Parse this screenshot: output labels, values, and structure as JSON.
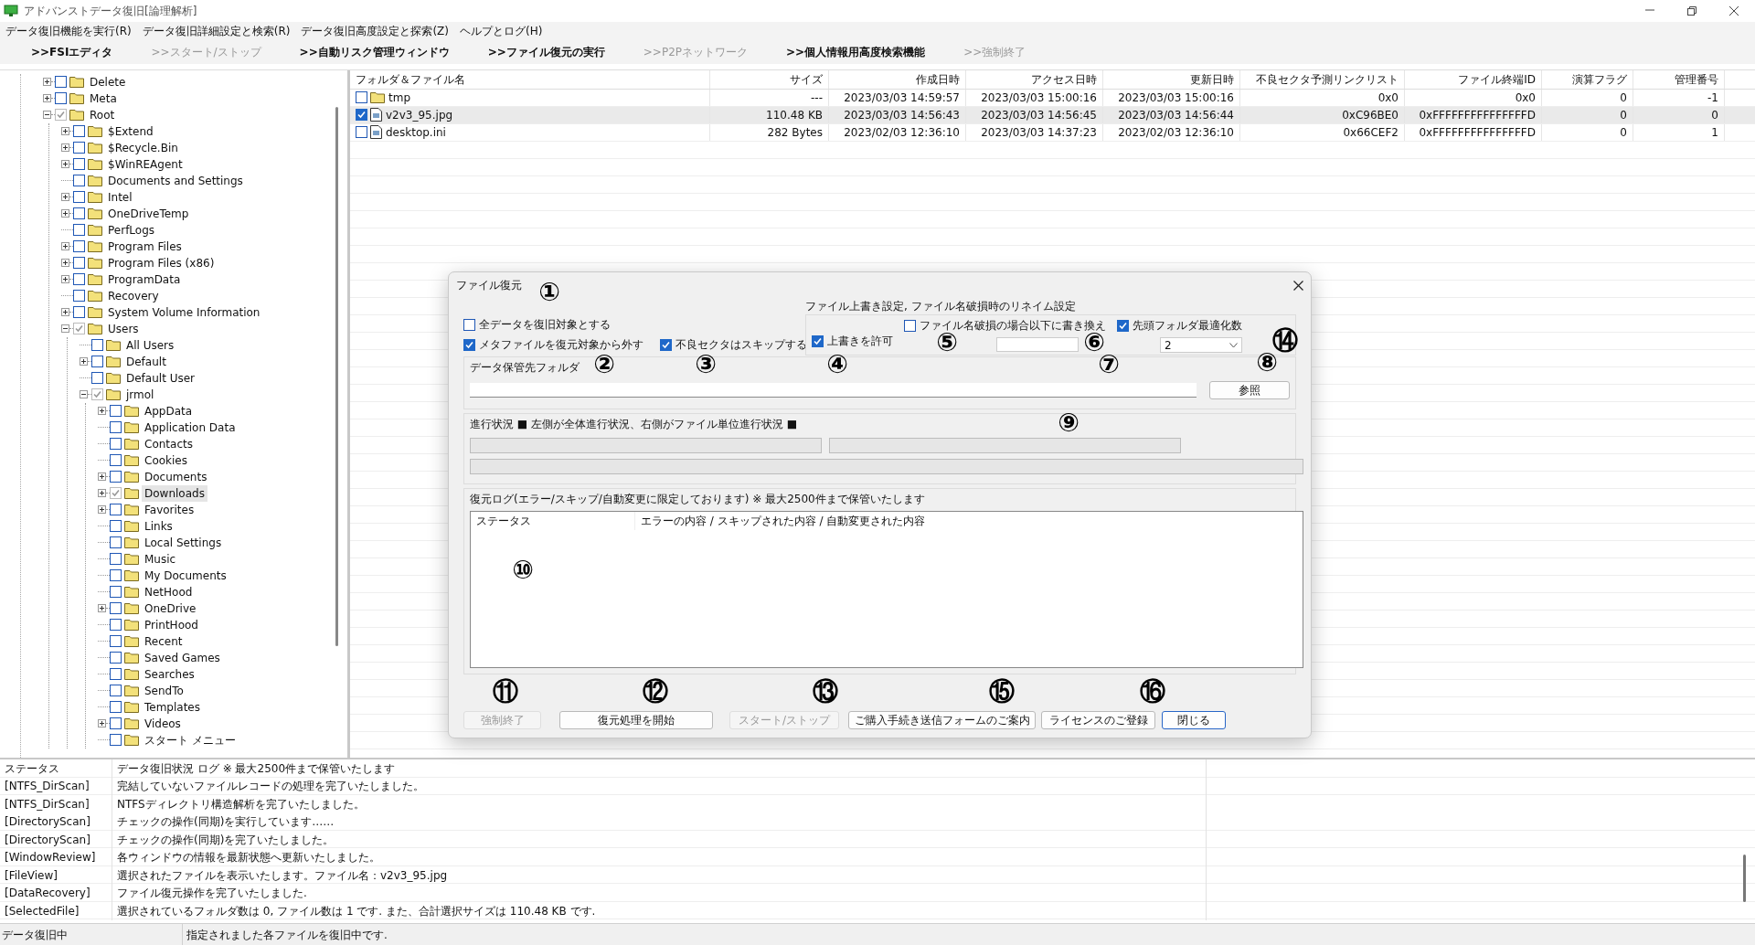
{
  "window": {
    "title": "アドバンストデータ復旧[論理解析]"
  },
  "menu": [
    "データ復旧機能を実行(R)",
    "データ復旧詳細設定と検索(R)",
    "データ復旧高度設定と探索(Z)",
    "ヘルプとログ(H)"
  ],
  "toolbar": [
    {
      "label": ">>FSIエディタ",
      "disabled": false
    },
    {
      "label": ">>スタート/ストップ",
      "disabled": true
    },
    {
      "label": ">>自動リスク管理ウィンドウ",
      "disabled": false
    },
    {
      "label": ">>ファイル復元の実行",
      "disabled": false
    },
    {
      "label": ">>P2Pネットワーク",
      "disabled": true
    },
    {
      "label": ">>個人情報用高度検索機能",
      "disabled": false
    },
    {
      "label": ">>強制終了",
      "disabled": true
    }
  ],
  "tree": [
    {
      "label": "Delete",
      "kind": "collapsed",
      "checked": false,
      "selected": false
    },
    {
      "label": "Meta",
      "kind": "collapsed",
      "checked": false,
      "selected": false
    },
    {
      "label": "Root",
      "kind": "expanded",
      "checked": true,
      "selected": false,
      "children": [
        {
          "label": "$Extend",
          "kind": "collapsed",
          "checked": false,
          "selected": false
        },
        {
          "label": "$Recycle.Bin",
          "kind": "collapsed",
          "checked": false,
          "selected": false
        },
        {
          "label": "$WinREAgent",
          "kind": "collapsed",
          "checked": false,
          "selected": false
        },
        {
          "label": "Documents and Settings",
          "kind": "leaf",
          "checked": false,
          "selected": false
        },
        {
          "label": "Intel",
          "kind": "collapsed",
          "checked": false,
          "selected": false
        },
        {
          "label": "OneDriveTemp",
          "kind": "collapsed",
          "checked": false,
          "selected": false
        },
        {
          "label": "PerfLogs",
          "kind": "leaf",
          "checked": false,
          "selected": false
        },
        {
          "label": "Program Files",
          "kind": "collapsed",
          "checked": false,
          "selected": false
        },
        {
          "label": "Program Files (x86)",
          "kind": "collapsed",
          "checked": false,
          "selected": false
        },
        {
          "label": "ProgramData",
          "kind": "collapsed",
          "checked": false,
          "selected": false
        },
        {
          "label": "Recovery",
          "kind": "leaf",
          "checked": false,
          "selected": false
        },
        {
          "label": "System Volume Information",
          "kind": "collapsed",
          "checked": false,
          "selected": false
        },
        {
          "label": "Users",
          "kind": "expanded",
          "checked": true,
          "selected": false,
          "children": [
            {
              "label": "All Users",
              "kind": "leaf",
              "checked": false,
              "selected": false
            },
            {
              "label": "Default",
              "kind": "collapsed",
              "checked": false,
              "selected": false
            },
            {
              "label": "Default User",
              "kind": "leaf",
              "checked": false,
              "selected": false
            },
            {
              "label": "jrmol",
              "kind": "expanded",
              "checked": true,
              "selected": false,
              "children": [
                {
                  "label": "AppData",
                  "kind": "collapsed",
                  "checked": false,
                  "selected": false
                },
                {
                  "label": "Application Data",
                  "kind": "leaf",
                  "checked": false,
                  "selected": false
                },
                {
                  "label": "Contacts",
                  "kind": "leaf",
                  "checked": false,
                  "selected": false
                },
                {
                  "label": "Cookies",
                  "kind": "leaf",
                  "checked": false,
                  "selected": false
                },
                {
                  "label": "Documents",
                  "kind": "collapsed",
                  "checked": false,
                  "selected": false
                },
                {
                  "label": "Downloads",
                  "kind": "collapsed",
                  "checked": true,
                  "selected": true
                },
                {
                  "label": "Favorites",
                  "kind": "collapsed",
                  "checked": false,
                  "selected": false
                },
                {
                  "label": "Links",
                  "kind": "leaf",
                  "checked": false,
                  "selected": false
                },
                {
                  "label": "Local Settings",
                  "kind": "leaf",
                  "checked": false,
                  "selected": false
                },
                {
                  "label": "Music",
                  "kind": "leaf",
                  "checked": false,
                  "selected": false
                },
                {
                  "label": "My Documents",
                  "kind": "leaf",
                  "checked": false,
                  "selected": false
                },
                {
                  "label": "NetHood",
                  "kind": "leaf",
                  "checked": false,
                  "selected": false
                },
                {
                  "label": "OneDrive",
                  "kind": "collapsed",
                  "checked": false,
                  "selected": false
                },
                {
                  "label": "PrintHood",
                  "kind": "leaf",
                  "checked": false,
                  "selected": false
                },
                {
                  "label": "Recent",
                  "kind": "leaf",
                  "checked": false,
                  "selected": false
                },
                {
                  "label": "Saved Games",
                  "kind": "leaf",
                  "checked": false,
                  "selected": false
                },
                {
                  "label": "Searches",
                  "kind": "leaf",
                  "checked": false,
                  "selected": false
                },
                {
                  "label": "SendTo",
                  "kind": "leaf",
                  "checked": false,
                  "selected": false
                },
                {
                  "label": "Templates",
                  "kind": "leaf",
                  "checked": false,
                  "selected": false
                },
                {
                  "label": "Videos",
                  "kind": "collapsed",
                  "checked": false,
                  "selected": false
                },
                {
                  "label": "スタート メニュー",
                  "kind": "leaf",
                  "checked": false,
                  "selected": false
                }
              ]
            }
          ]
        }
      ]
    }
  ],
  "file_list": {
    "columns": [
      "フォルダ＆ファイル名",
      "サイズ",
      "作成日時",
      "アクセス日時",
      "更新日時",
      "不良セクタ予測リンクリスト",
      "ファイル終端ID",
      "演算フラグ",
      "管理番号"
    ],
    "rows": [
      {
        "kind": "folder",
        "checked": false,
        "selected": false,
        "cells": [
          "tmp",
          "---",
          "2023/03/03 14:59:57",
          "2023/03/03 15:00:16",
          "2023/03/03 15:00:16",
          "0x0",
          "0x0",
          "0",
          "-1"
        ]
      },
      {
        "kind": "file",
        "checked": true,
        "selected": true,
        "cells": [
          "v2v3_95.jpg",
          "110.48 KB",
          "2023/03/03 14:56:43",
          "2023/03/03 14:56:45",
          "2023/03/03 14:56:44",
          "0xC96BE0",
          "0xFFFFFFFFFFFFFFFD",
          "0",
          "0"
        ]
      },
      {
        "kind": "file",
        "checked": false,
        "selected": false,
        "cells": [
          "desktop.ini",
          "282 Bytes",
          "2023/02/03 12:36:10",
          "2023/03/03 14:37:23",
          "2023/02/03 12:36:10",
          "0x66CEF2",
          "0xFFFFFFFFFFFFFFFD",
          "0",
          "1"
        ]
      }
    ]
  },
  "dialog": {
    "title": "ファイル復元",
    "options": [
      {
        "label": "全データを復旧対象とする",
        "checked": false
      },
      {
        "label": "メタファイルを復元対象から外す",
        "checked": true
      },
      {
        "label": "不良セクタはスキップする",
        "checked": true
      }
    ],
    "overwrite_group": {
      "title": "ファイル上書き設定, ファイル名破損時のリネイム設定",
      "options": [
        {
          "label": "上書きを許可",
          "checked": true
        },
        {
          "label": "ファイル名破損の場合以下に書き換え",
          "checked": false
        },
        {
          "label": "先頭フォルダ最適化数",
          "checked": true
        }
      ],
      "optimize_count": "2"
    },
    "folder_group": {
      "title": "データ保管先フォルダ",
      "browse_button": "参照"
    },
    "progress_group": {
      "title": "進行状況 ■ 左側が全体進行状況、右側がファイル単位進行状況 ■",
      "bars": [
        {
          "level": 0
        },
        {
          "level": 0
        },
        {
          "level": 0
        }
      ]
    },
    "log_group": {
      "title": "復元ログ(エラー/スキップ/自動変更に限定しております) ※ 最大2500件まで保管いたします",
      "columns": [
        "ステータス",
        "エラーの内容 / スキップされた内容 / 自動変更された内容"
      ]
    },
    "buttons": [
      {
        "label": "強制終了",
        "disabled": true
      },
      {
        "label": "復元処理を開始",
        "disabled": false
      },
      {
        "label": "スタート/ストップ",
        "disabled": true
      },
      {
        "label": "ご購入手続き送信フォームのご案内",
        "disabled": false
      },
      {
        "label": "ライセンスのご登録",
        "disabled": false
      },
      {
        "label": "閉じる",
        "disabled": false
      }
    ]
  },
  "callouts": [
    "①",
    "②",
    "③",
    "④",
    "⑤",
    "⑥",
    "⑦",
    "⑧",
    "⑨",
    "⑩",
    "⑪",
    "⑫",
    "⑬",
    "⑭",
    "⑮",
    "⑯"
  ],
  "log": {
    "columns": [
      "ステータス",
      "データ復旧状況 ログ ※ 最大2500件まで保管いたします"
    ],
    "rows": [
      {
        "status": "[NTFS_DirScan]",
        "message": "完結していないファイルレコードの処理を完了いたしました。"
      },
      {
        "status": "[NTFS_DirScan]",
        "message": "NTFSディレクトリ構造解析を完了いたしました。"
      },
      {
        "status": "[DirectoryScan]",
        "message": "チェックの操作(同期)を実行しています……"
      },
      {
        "status": "[DirectoryScan]",
        "message": "チェックの操作(同期)を完了いたしました。"
      },
      {
        "status": "[WindowReview]",
        "message": "各ウィンドウの情報を最新状態へ更新いたしました。"
      },
      {
        "status": "[FileView]",
        "message": "選択されたファイルを表示いたします。ファイル名：v2v3_95.jpg"
      },
      {
        "status": "[DataRecovery]",
        "message": "ファイル復元操作を完了いたしました."
      },
      {
        "status": "[SelectedFile]",
        "message": "選択されているフォルダ数は 0, ファイル数は 1 です. また、合計選択サイズは 110.48 KB です."
      }
    ]
  },
  "status_bar": [
    "データ復旧中",
    "指定されました各ファイルを復旧中です."
  ]
}
